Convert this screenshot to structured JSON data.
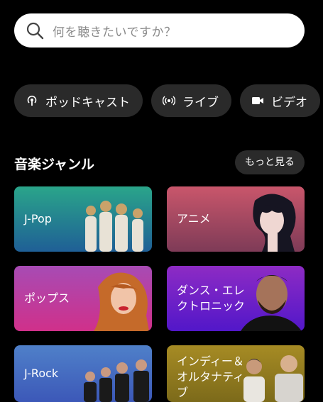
{
  "search": {
    "placeholder": "何を聴きたいですか？",
    "icon": "search-icon"
  },
  "chips": [
    {
      "label": "ポッドキャスト",
      "icon": "podcast-icon"
    },
    {
      "label": "ライブ",
      "icon": "live-broadcast-icon"
    },
    {
      "label": "ビデオ",
      "icon": "video-camera-icon"
    }
  ],
  "genres": {
    "title": "音楽ジャンル",
    "more_label": "もっと見る",
    "cards": [
      {
        "label": "J-Pop",
        "color": "#2aa58a"
      },
      {
        "label": "アニメ",
        "color": "#c9566b"
      },
      {
        "label": "ポップス",
        "color": "#b23ea0"
      },
      {
        "label": "ダンス・エレ\nクトロニック",
        "color": "#7a22c6"
      },
      {
        "label": "J-Rock",
        "color": "#4f80c9"
      },
      {
        "label": "インディー＆\nオルタナティ\nブ",
        "color": "#a68b24"
      }
    ]
  }
}
